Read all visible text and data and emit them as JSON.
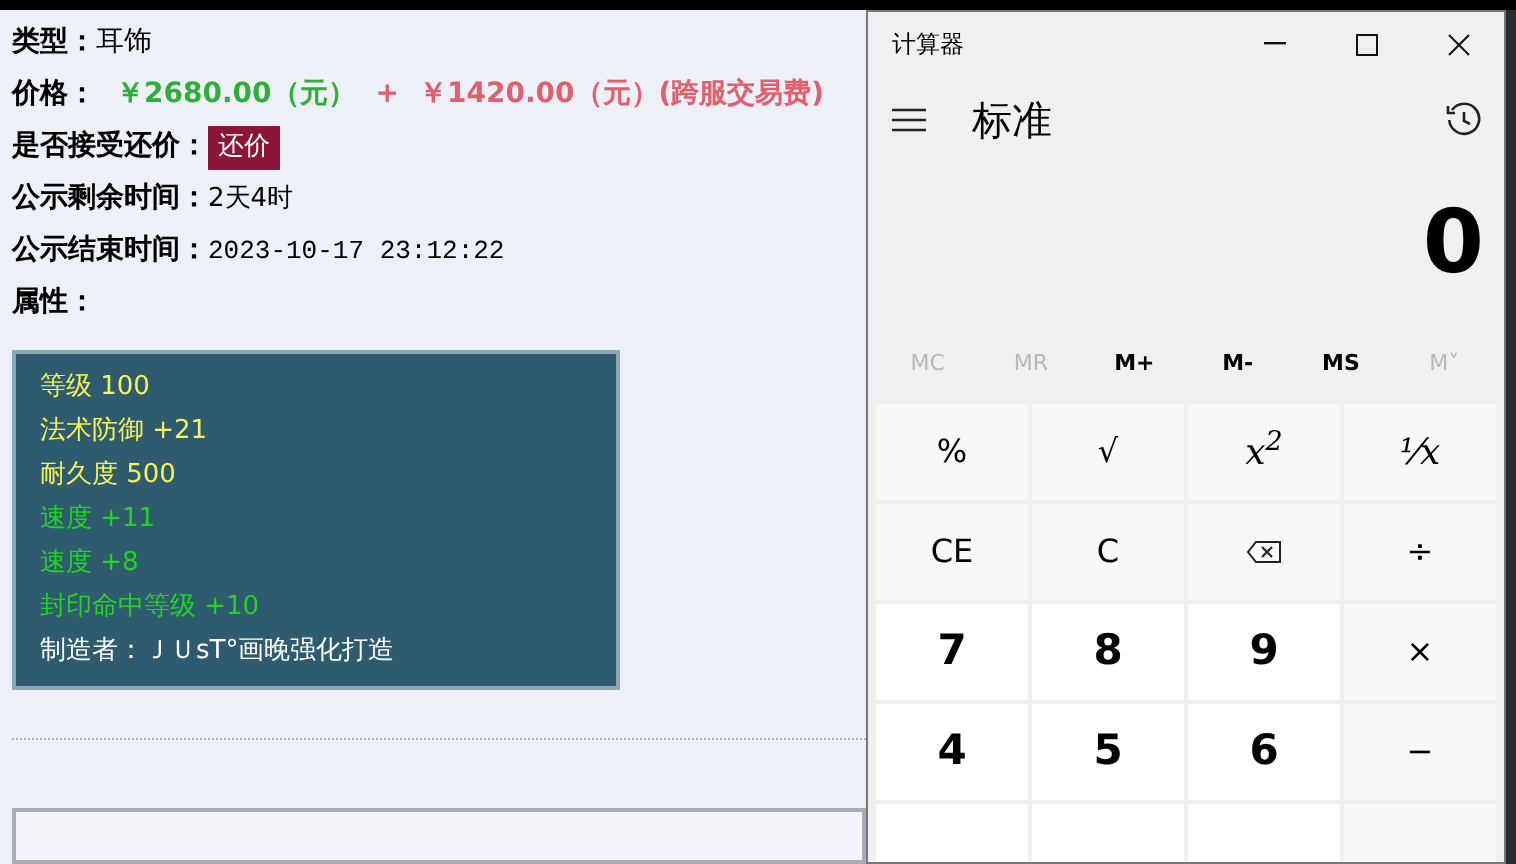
{
  "listing": {
    "type_label": "类型：",
    "type_value": "耳饰",
    "price_label": "价格：",
    "price_parts": [
      {
        "text": "￥2680.00（元）",
        "color": "#2fae3a"
      },
      {
        "text": "+",
        "color": "#e0606e"
      },
      {
        "text": "￥1420.00（元）(跨服交易费)",
        "color": "#e0606e"
      }
    ],
    "counter_offer_label": "是否接受还价：",
    "counter_offer_button": "还价",
    "remaining_label": "公示剩余时间：",
    "remaining_value": "2天4时",
    "end_label": "公示结束时间：",
    "end_value": "2023-10-17 23:12:22",
    "attributes_label": "属性：",
    "attributes": [
      {
        "text": "等级 100",
        "color": "#f2f25a"
      },
      {
        "text": "法术防御 +21",
        "color": "#f2f25a"
      },
      {
        "text": "耐久度 500",
        "color": "#f2f25a"
      },
      {
        "text": "速度 +11",
        "color": "#22d422"
      },
      {
        "text": "速度 +8",
        "color": "#22d422"
      },
      {
        "text": "封印命中等级 +10",
        "color": "#22d422"
      },
      {
        "text": "制造者：ＪＵsT°画晚强化打造",
        "color": "#ffffff"
      }
    ]
  },
  "calculator": {
    "window_title": "计算器",
    "mode": "标准",
    "display": "0",
    "memory": [
      {
        "label": "MC",
        "disabled": true
      },
      {
        "label": "MR",
        "disabled": true
      },
      {
        "label": "M+",
        "disabled": false
      },
      {
        "label": "M-",
        "disabled": false
      },
      {
        "label": "MS",
        "disabled": false
      },
      {
        "label": "M˅",
        "disabled": true
      }
    ],
    "keys": [
      {
        "kind": "function",
        "label": "%"
      },
      {
        "kind": "function",
        "label": "√"
      },
      {
        "kind": "math",
        "label": "x$^{2}$"
      },
      {
        "kind": "math",
        "label": "¹⁄x"
      },
      {
        "kind": "function",
        "label": "CE"
      },
      {
        "kind": "function",
        "label": "C"
      },
      {
        "kind": "backspace"
      },
      {
        "kind": "operator",
        "label": "÷"
      },
      {
        "kind": "number",
        "label": "7"
      },
      {
        "kind": "number",
        "label": "8"
      },
      {
        "kind": "number",
        "label": "9"
      },
      {
        "kind": "operator",
        "label": "×"
      },
      {
        "kind": "number",
        "label": "4"
      },
      {
        "kind": "number",
        "label": "5"
      },
      {
        "kind": "number",
        "label": "6"
      },
      {
        "kind": "operator",
        "label": "−"
      },
      {
        "kind": "number"
      },
      {
        "kind": "number"
      },
      {
        "kind": "number"
      },
      {
        "kind": "operator"
      }
    ]
  }
}
